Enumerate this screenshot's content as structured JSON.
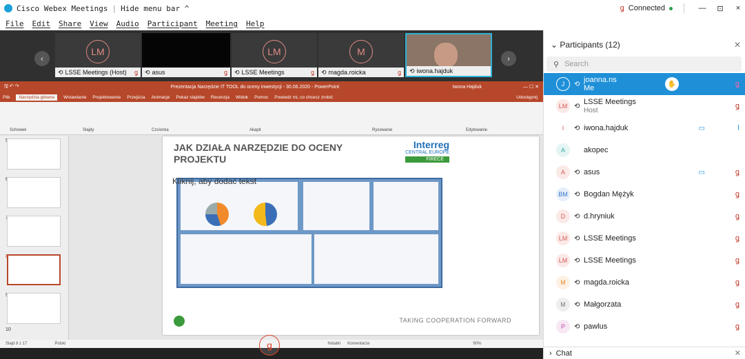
{
  "window": {
    "title": "Cisco Webex Meetings",
    "hide_menu": "Hide menu bar ^",
    "connected": "Connected",
    "win_min": "—",
    "win_restore": "⊡",
    "win_close": "×"
  },
  "menu": [
    "File",
    "Edit",
    "Share",
    "View",
    "Audio",
    "Participant",
    "Meeting",
    "Help"
  ],
  "strip": {
    "tiles": [
      {
        "initials": "LM",
        "name": "LSSE Meetings (Host)"
      },
      {
        "initials": "",
        "name": "asus"
      },
      {
        "initials": "LM",
        "name": "LSSE Meetings"
      },
      {
        "initials": "M",
        "name": "magda.roicka"
      },
      {
        "initials": "",
        "name": "iwona.hajduk"
      }
    ]
  },
  "ppt": {
    "title": "Prezentacja Narzędzie IT TOOL do oceny inwestycji - 30.06.2020 - PowerPoint",
    "user": "Iwona Hajduk",
    "tabs": [
      "Plik",
      "Narzędzia główne",
      "Wstawianie",
      "Projektowanie",
      "Przejścia",
      "Animacje",
      "Pokaz slajdów",
      "Recenzja",
      "Widok",
      "Pomoc",
      "Powiedz mi, co chcesz zrobić"
    ],
    "share": "Udostępnij",
    "groups": [
      "Schowek",
      "Slajdy",
      "Czcionka",
      "Akapit",
      "Rysowanie",
      "Edytowanie"
    ],
    "slide_numbers": [
      "5",
      "6",
      "7",
      "8",
      "9",
      "10"
    ],
    "slide_title": "JAK DZIAŁA NARZĘDZIE DO OCENY PROJEKTU",
    "slide_placeholder": "Kliknij, aby dodać tekst",
    "slide_footer": "TAKING COOPERATION FORWARD",
    "logo_text": "Interreg",
    "logo_sub": "CENTRAL EUROPE",
    "logo_tag": "FIRECE",
    "status_left": "Slajd 8 z 17",
    "status_lang": "Polski",
    "notes": "Notatki",
    "comments": "Komentarze",
    "zoom": "90%"
  },
  "panel": {
    "title": "Participants (12)",
    "search_placeholder": "Search",
    "participants": [
      {
        "initials": "J",
        "name": "joanna.ns",
        "sub": "Me"
      },
      {
        "initials": "LM",
        "name": "LSSE Meetings",
        "sub": "Host"
      },
      {
        "initials": "I",
        "name": "iwona.hajduk",
        "sub": ""
      },
      {
        "initials": "A",
        "name": "akopec",
        "sub": ""
      },
      {
        "initials": "A",
        "name": "asus",
        "sub": ""
      },
      {
        "initials": "BM",
        "name": "Bogdan Mężyk",
        "sub": ""
      },
      {
        "initials": "D",
        "name": "d.hryniuk",
        "sub": ""
      },
      {
        "initials": "LM",
        "name": "LSSE Meetings",
        "sub": ""
      },
      {
        "initials": "LM",
        "name": "LSSE Meetings",
        "sub": ""
      },
      {
        "initials": "M",
        "name": "magda.roicka",
        "sub": ""
      },
      {
        "initials": "M",
        "name": "Małgorzata",
        "sub": ""
      },
      {
        "initials": "P",
        "name": "pawlus",
        "sub": ""
      }
    ],
    "chat": "Chat"
  },
  "colors": {
    "accent": "#1f90d8",
    "ppt": "#b7472a",
    "muted_red": "#c03a2b",
    "connected_green": "#2e9e4b"
  }
}
